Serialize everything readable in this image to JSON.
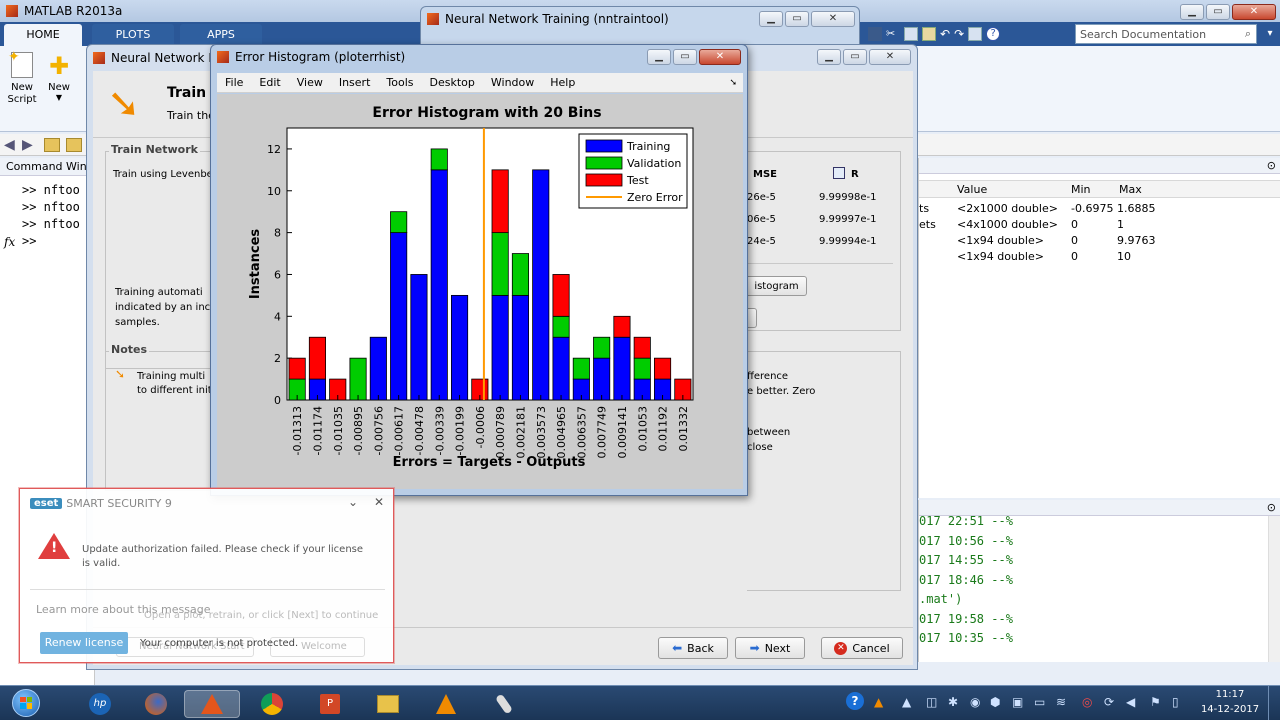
{
  "matlab": {
    "title": "MATLAB R2013a",
    "tabs": [
      "HOME",
      "PLOTS",
      "APPS"
    ],
    "toolbar": {
      "new_script": "New\nScript",
      "new": "New"
    },
    "search_placeholder": "Search Documentation",
    "command_window": {
      "title": "Command Wind",
      "lines": [
        ">> nftoo",
        ">> nftoo",
        ">> nftoo",
        ">>"
      ],
      "prompt_glyph": "fx"
    },
    "workspace": {
      "headers": [
        "Value",
        "Min",
        "Max"
      ],
      "rows": [
        {
          "name": "ts",
          "value": "<2x1000 double>",
          "min": "-0.6975",
          "max": "1.6885"
        },
        {
          "name": "ets",
          "value": "<4x1000 double>",
          "min": "0",
          "max": "1"
        },
        {
          "name": "",
          "value": "<1x94 double>",
          "min": "0",
          "max": "9.9763"
        },
        {
          "name": "",
          "value": "<1x94 double>",
          "min": "0",
          "max": "10"
        }
      ]
    },
    "history": [
      "017 22:51 --%",
      "017 10:56 --%",
      "017 14:55 --%",
      "017 18:46 --%",
      ".mat')",
      "017 19:58 --%",
      "017 10:35 --%"
    ]
  },
  "nntraintool": {
    "title": "Neural Network Training (nntraintool)"
  },
  "nnfit": {
    "title": "Neural Network Fitt",
    "heading": "Train",
    "subheading": "Train the",
    "train_group": "Train Network",
    "train_using": "Train using Levenbe",
    "auto_text_1": "Training automati",
    "auto_text_2": "indicated by an inc",
    "auto_text_3": "samples.",
    "notes_group": "Notes",
    "notes_1": "Training multi",
    "notes_2": "to different init",
    "results": {
      "mse_header": "MSE",
      "r_header": "R",
      "mse": [
        "26e-5",
        "06e-5",
        "24e-5"
      ],
      "r": [
        "9.99998e-1",
        "9.99997e-1",
        "9.99994e-1"
      ]
    },
    "histogram_button": "istogram",
    "right_notes": [
      "fference",
      "e better. Zero",
      "between",
      "close"
    ],
    "back": "Back",
    "next": "Next",
    "cancel": "Cancel",
    "ghost_text": "Open a plot, retrain, or click [Next] to continue",
    "ghost_buttons": [
      "Neural Network Start",
      "Welcome"
    ]
  },
  "errhist": {
    "title": "Error Histogram (ploterrhist)",
    "menu": [
      "File",
      "Edit",
      "View",
      "Insert",
      "Tools",
      "Desktop",
      "Window",
      "Help"
    ]
  },
  "chart_data": {
    "type": "bar",
    "title": "Error Histogram with 20 Bins",
    "xlabel": "Errors = Targets - Outputs",
    "ylabel": "Instances",
    "ylim": [
      0,
      13
    ],
    "yticks": [
      0,
      2,
      4,
      6,
      8,
      10,
      12
    ],
    "stacked": true,
    "categories": [
      "-0.01313",
      "-0.01174",
      "-0.01035",
      "-0.00895",
      "-0.00756",
      "-0.00617",
      "-0.00478",
      "-0.00339",
      "-0.00199",
      "-0.0006",
      "0.000789",
      "0.002181",
      "0.003573",
      "0.004965",
      "0.006357",
      "0.007749",
      "0.009141",
      "0.01053",
      "0.01192",
      "0.01332"
    ],
    "series": [
      {
        "name": "Training",
        "color": "#0000ff",
        "values": [
          0,
          1,
          0,
          0,
          3,
          8,
          6,
          11,
          5,
          0,
          5,
          5,
          11,
          3,
          1,
          2,
          3,
          1,
          1,
          0
        ]
      },
      {
        "name": "Validation",
        "color": "#00cc00",
        "values": [
          1,
          0,
          0,
          2,
          0,
          1,
          0,
          1,
          0,
          0,
          3,
          2,
          0,
          1,
          1,
          1,
          0,
          1,
          0,
          0
        ]
      },
      {
        "name": "Test",
        "color": "#ff0000",
        "values": [
          1,
          2,
          1,
          0,
          0,
          0,
          0,
          0,
          0,
          1,
          3,
          0,
          0,
          2,
          0,
          0,
          1,
          1,
          1,
          1
        ]
      }
    ],
    "zero_error": {
      "name": "Zero Error",
      "color": "#ff9900",
      "bin_index": 9.7
    },
    "legend": "top-right"
  },
  "eset": {
    "logo": "eset",
    "title": "SMART SECURITY 9",
    "message": "Update authorization failed. Please check if your license is valid.",
    "link": "Learn more about this message",
    "button": "Renew license",
    "status": "Your computer is not protected."
  },
  "taskbar": {
    "time": "11:17",
    "date": "14-12-2017"
  }
}
